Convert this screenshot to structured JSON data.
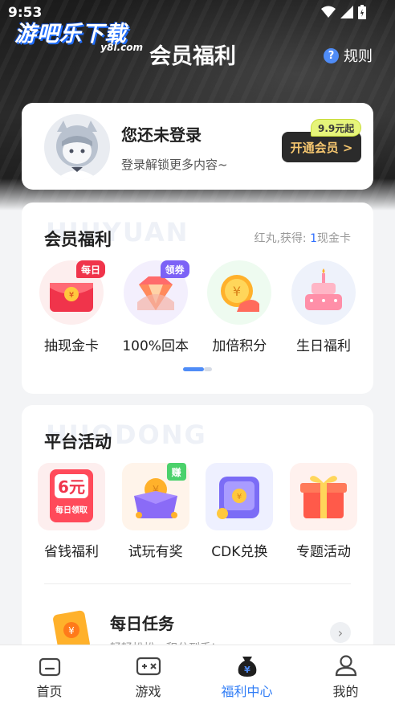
{
  "status_bar": {
    "time": "9:53"
  },
  "header": {
    "logo_main": "游吧乐下载",
    "logo_sub": "y8l.com",
    "title": "会员福利",
    "rules_label": "规则"
  },
  "login_card": {
    "title": "您还未登录",
    "subtitle": "登录解锁更多内容~",
    "vip_button": "开通会员 >",
    "vip_tag": "9.9元起"
  },
  "member_benefits": {
    "watermark": "HUIYUAN",
    "title": "会员福利",
    "extra_prefix": "红丸,获得: ",
    "extra_num": "1",
    "extra_suffix": "现金卡",
    "items": [
      {
        "label": "抽现金卡",
        "badge": "每日"
      },
      {
        "label": "100%回本",
        "badge": "领券"
      },
      {
        "label": "加倍积分",
        "badge": ""
      },
      {
        "label": "生日福利",
        "badge": ""
      }
    ]
  },
  "platform_activities": {
    "watermark": "HUODONG",
    "title": "平台活动",
    "items": [
      {
        "label": "省钱福利",
        "badge": "",
        "icon_text": "6元",
        "icon_sub": "每日领取"
      },
      {
        "label": "试玩有奖",
        "badge": "赚"
      },
      {
        "label": "CDK兑换",
        "badge": ""
      },
      {
        "label": "专题活动",
        "badge": ""
      }
    ],
    "task": {
      "title": "每日任务",
      "subtitle": "轻轻松松，积分到手!"
    }
  },
  "bottom_nav": [
    {
      "label": "首页",
      "icon": "home-icon"
    },
    {
      "label": "游戏",
      "icon": "gamepad-icon"
    },
    {
      "label": "福利中心",
      "icon": "money-bag-icon",
      "active": true
    },
    {
      "label": "我的",
      "icon": "user-icon"
    }
  ],
  "colors": {
    "accent": "#2f7cf6",
    "vip_gold": "#f5c66f",
    "badge_red": "#f0344b",
    "badge_purple": "#7c62f6"
  }
}
